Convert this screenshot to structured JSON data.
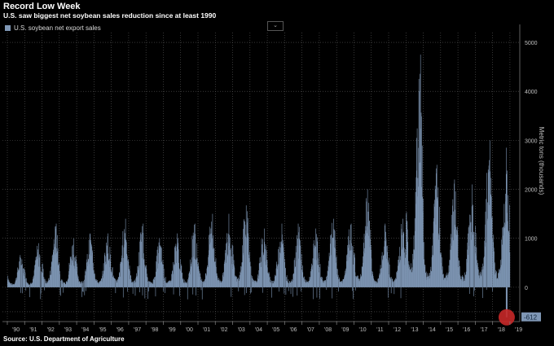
{
  "header": {
    "title": "Record Low Week",
    "subtitle": "U.S. saw biggest net soybean sales reduction since at least 1990"
  },
  "footer": {
    "source": "Source: U.S. Department of Agriculture"
  },
  "colors": {
    "bar": "#7f97b5",
    "highlight": "#c62828",
    "background": "#000000",
    "grid": "#5a5a5a"
  },
  "icons": {
    "chart_tool": "chart-type-icon"
  },
  "chart_data": {
    "type": "bar",
    "title": "Record Low Week",
    "subtitle": "U.S. saw biggest net soybean sales reduction since at least 1990",
    "ylabel": "Metric tons (thousands)",
    "xlabel": "",
    "ylim": [
      -700,
      5200
    ],
    "yticks": [
      -500,
      0,
      1000,
      2000,
      3000,
      4000,
      5000
    ],
    "grid": true,
    "legend": "top-left",
    "series": [
      {
        "name": "U.S. soybean net export sales",
        "frequency": "weekly"
      }
    ],
    "x_tick_labels": [
      "'90",
      "'91",
      "'92",
      "'93",
      "'94",
      "'95",
      "'96",
      "'97",
      "'98",
      "'99",
      "'00",
      "'01",
      "'02",
      "'03",
      "'04",
      "'05",
      "'06",
      "'07",
      "'08",
      "'09",
      "'10",
      "'11",
      "'12",
      "'13",
      "'14",
      "'15",
      "'16",
      "'17",
      "'18",
      "'19"
    ],
    "yearly_peaks": [
      {
        "year": "'90",
        "peak": 700
      },
      {
        "year": "'91",
        "peak": 900
      },
      {
        "year": "'92",
        "peak": 1300
      },
      {
        "year": "'93",
        "peak": 1000
      },
      {
        "year": "'94",
        "peak": 1100
      },
      {
        "year": "'95",
        "peak": 1100
      },
      {
        "year": "'96",
        "peak": 1400
      },
      {
        "year": "'97",
        "peak": 1300
      },
      {
        "year": "'98",
        "peak": 1000
      },
      {
        "year": "'99",
        "peak": 1100
      },
      {
        "year": "'00",
        "peak": 1300
      },
      {
        "year": "'01",
        "peak": 1500
      },
      {
        "year": "'02",
        "peak": 1500
      },
      {
        "year": "'03",
        "peak": 1850
      },
      {
        "year": "'04",
        "peak": 1200
      },
      {
        "year": "'05",
        "peak": 1300
      },
      {
        "year": "'06",
        "peak": 1300
      },
      {
        "year": "'07",
        "peak": 1200
      },
      {
        "year": "'08",
        "peak": 1400
      },
      {
        "year": "'09",
        "peak": 1300
      },
      {
        "year": "'10",
        "peak": 2000
      },
      {
        "year": "'11",
        "peak": 1300
      },
      {
        "year": "'12",
        "peak": 1400
      },
      {
        "year": "'13",
        "peak": 4750
      },
      {
        "year": "'14",
        "peak": 2500
      },
      {
        "year": "'15",
        "peak": 2200
      },
      {
        "year": "'16",
        "peak": 2100
      },
      {
        "year": "'17",
        "peak": 3000
      },
      {
        "year": "'18",
        "peak": 2850
      }
    ],
    "annotations": [
      {
        "label": "-612",
        "value": -612,
        "note": "latest week"
      }
    ]
  }
}
